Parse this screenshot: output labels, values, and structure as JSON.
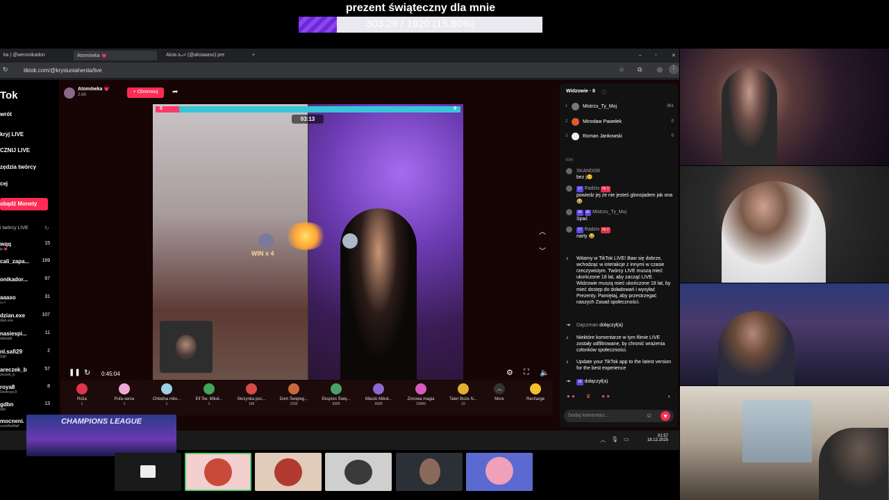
{
  "goal": {
    "title": "prezent świąteczny dla mnie",
    "progress_text": "303.29 / 1920 (15.80%)",
    "progress_fraction": 0.158
  },
  "browser": {
    "tabs": [
      "ka | @weronikadon",
      "Atomówka 💗",
      "Alcia ≥⁠ᴗ⁠< (@alciaaaso) pre"
    ],
    "url": "tiktok.com/@krysiuniaherda/live"
  },
  "sidebar": {
    "logo": "Tok",
    "items": [
      "wrót",
      "kryj LIVE",
      "CZNIJ LIVE",
      "zędzia twórcy",
      "cej"
    ],
    "buy_coins": "obądź Monety",
    "recommended_header": "i twórcy LIVE",
    "recommended": [
      {
        "name": "wqq",
        "sub": "ja 💗",
        "count": "15"
      },
      {
        "name": "cali_zapa...",
        "sub": "",
        "count": "169"
      },
      {
        "name": "onikador...",
        "sub": "",
        "count": "97"
      },
      {
        "name": "aaaxo",
        "sub": "≥⁠ᴗ⁠<",
        "count": "31"
      },
      {
        "name": "dzian.exe",
        "sub": "dian.exe",
        "count": "107"
      },
      {
        "name": "nasiespi...",
        "sub": "diskaa8",
        "count": "11"
      },
      {
        "name": "nl.safi29",
        "sub": "Safi",
        "count": "2"
      },
      {
        "name": "areczek_b",
        "sub": "zeczek_b",
        "count": "57"
      },
      {
        "name": "roya8",
        "sub": "Destroya 8",
        "count": "8"
      },
      {
        "name": "gdbn",
        "sub": "dbn",
        "count": "13"
      },
      {
        "name": "mocneni.",
        "sub": "ocneNieMaF",
        "count": ""
      }
    ]
  },
  "live": {
    "host_name": "Atomówka 💗",
    "host_likes": "2.6K",
    "follow_label": "+ Obserwuj",
    "battle_timer": "03:13",
    "battle_left_score": "0",
    "battle_right_score": "9",
    "win_label": "WIN x 4",
    "elapsed": "0:45:04"
  },
  "gifts": [
    {
      "name": "Róża",
      "price": "1"
    },
    {
      "name": "Pufa-serce",
      "price": "1"
    },
    {
      "name": "Chłodna mito...",
      "price": "1"
    },
    {
      "name": "Elf Św. Mikoł...",
      "price": "1"
    },
    {
      "name": "Skrzynka poc...",
      "price": "199"
    },
    {
      "name": "Dom Święteg...",
      "price": "2200"
    },
    {
      "name": "Ekspres Świę...",
      "price": "5999"
    },
    {
      "name": "Miasto Mikoł...",
      "price": "9999"
    },
    {
      "name": "Zimowa magia",
      "price": "19999"
    },
    {
      "name": "Tater Boże N...",
      "price": "10"
    }
  ],
  "gift_more": "More",
  "recharge": "Recharge",
  "chat": {
    "viewers_title": "Widzowie · 8",
    "viewers": [
      {
        "rank": "1",
        "name": "Mistrzu_Ty_Moj",
        "score": "361"
      },
      {
        "rank": "2",
        "name": "Mirosław Pawełek",
        "score": "0"
      },
      {
        "rank": "3",
        "name": "Roman Jankowski",
        "score": "0"
      }
    ],
    "faded_line": "kiei",
    "messages": [
      {
        "user": "SKANDI38",
        "badge": "",
        "text": "bez j😊"
      },
      {
        "user": "Radzio",
        "badge": "17",
        "badge2": "Nr 1",
        "text": "powiedz jej że nie jesteś glonojadem jak ona 😂"
      },
      {
        "user": "Mistrzu_Ty_Moj",
        "badge": "40",
        "badge2": "40",
        "text": "Spać"
      },
      {
        "user": "Radzio",
        "badge": "17",
        "badge2": "Nr 2",
        "text": "narty 😂"
      }
    ],
    "system_welcome": "Witamy w TikTok LIVE! Baw się dobrze, wchodząc w interakcje z innymi w czasie rzeczywistym. Twórcy LIVE muszą mieć ukończone 18 lat, aby zacząć LIVE. Widzowie muszą mieć ukończone 18 lat, by mieć dostęp do doładowań i wysyłać Prezenty. Pamiętaj, aby przestrzegać naszych Zasad społeczności.",
    "joined_1_user": "Dajczman",
    "joined_1_text": "dołączył(a)",
    "filter_notice": "Niektóre komentarze w tym filmie LIVE zostały odfiltrowane, by chronić wrażenia członków społeczności.",
    "update_notice": "Update your TikTok app to the latest version for the best experience",
    "joined_2_badge": "18",
    "joined_2_text": "dołączył(a)",
    "input_placeholder": "Dodaj komentarz..."
  },
  "taskbar": {
    "time": "01:57",
    "date": "18.12.2025"
  },
  "banner": {
    "text": "CHAMPIONS LEAGUE"
  },
  "colors": {
    "tiktok_red": "#fe2c55",
    "goal_purple": "#7b35e0",
    "battle_cyan": "#35c7d9"
  }
}
